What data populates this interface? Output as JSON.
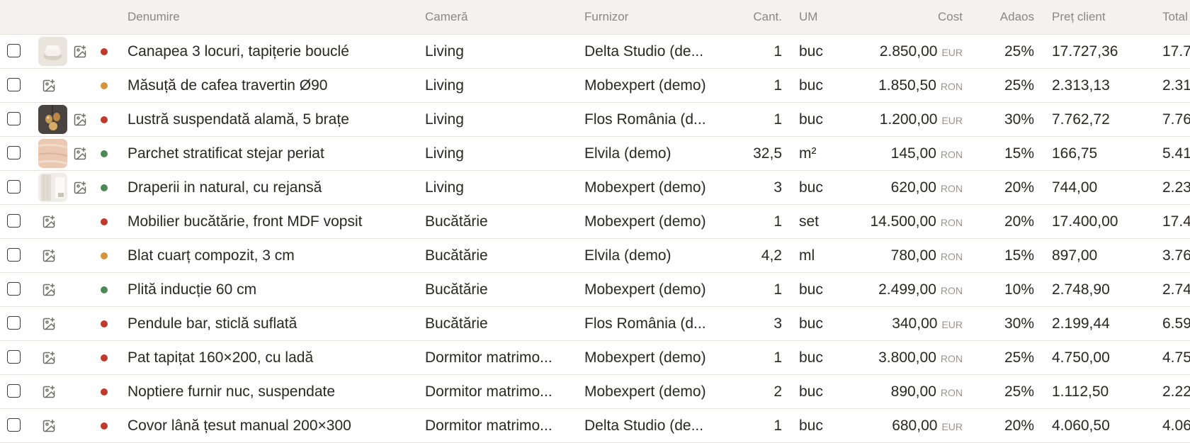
{
  "columns": {
    "name": "Denumire",
    "room": "Cameră",
    "supplier": "Furnizor",
    "qty": "Cant.",
    "um": "UM",
    "cost": "Cost",
    "markup": "Adaos",
    "client_price": "Preț client",
    "total": "Total"
  },
  "status_colors": {
    "red": "#c0392b",
    "orange": "#d4963a",
    "green": "#4a8a55"
  },
  "rows": [
    {
      "name": "Canapea 3 locuri, tapițerie bouclé",
      "room": "Living",
      "supplier": "Delta Studio (de...",
      "qty": "1",
      "um": "buc",
      "cost": "2.850,00",
      "currency": "EUR",
      "markup": "25%",
      "client_price": "17.727,36",
      "total": "17.7",
      "status": "red",
      "thumb": "sofa"
    },
    {
      "name": "Măsuță de cafea travertin Ø90",
      "room": "Living",
      "supplier": "Mobexpert (demo)",
      "qty": "1",
      "um": "buc",
      "cost": "1.850,50",
      "currency": "RON",
      "markup": "25%",
      "client_price": "2.313,13",
      "total": "2.31",
      "status": "orange",
      "thumb": ""
    },
    {
      "name": "Lustră suspendată alamă, 5 brațe",
      "room": "Living",
      "supplier": "Flos România (d...",
      "qty": "1",
      "um": "buc",
      "cost": "1.200,00",
      "currency": "EUR",
      "markup": "30%",
      "client_price": "7.762,72",
      "total": "7.76",
      "status": "red",
      "thumb": "lamp"
    },
    {
      "name": "Parchet stratificat stejar periat",
      "room": "Living",
      "supplier": "Elvila (demo)",
      "qty": "32,5",
      "um": "m²",
      "cost": "145,00",
      "currency": "RON",
      "markup": "15%",
      "client_price": "166,75",
      "total": "5.41",
      "status": "green",
      "thumb": "wood"
    },
    {
      "name": "Draperii in natural, cu rejansă",
      "room": "Living",
      "supplier": "Mobexpert (demo)",
      "qty": "3",
      "um": "buc",
      "cost": "620,00",
      "currency": "RON",
      "markup": "20%",
      "client_price": "744,00",
      "total": "2.23",
      "status": "green",
      "thumb": "curtain"
    },
    {
      "name": "Mobilier bucătărie, front MDF vopsit",
      "room": "Bucătărie",
      "supplier": "Mobexpert (demo)",
      "qty": "1",
      "um": "set",
      "cost": "14.500,00",
      "currency": "RON",
      "markup": "20%",
      "client_price": "17.400,00",
      "total": "17.4",
      "status": "red",
      "thumb": ""
    },
    {
      "name": "Blat cuarț compozit, 3 cm",
      "room": "Bucătărie",
      "supplier": "Elvila (demo)",
      "qty": "4,2",
      "um": "ml",
      "cost": "780,00",
      "currency": "RON",
      "markup": "15%",
      "client_price": "897,00",
      "total": "3.76",
      "status": "orange",
      "thumb": ""
    },
    {
      "name": "Plită inducție 60 cm",
      "room": "Bucătărie",
      "supplier": "Mobexpert (demo)",
      "qty": "1",
      "um": "buc",
      "cost": "2.499,00",
      "currency": "RON",
      "markup": "10%",
      "client_price": "2.748,90",
      "total": "2.74",
      "status": "green",
      "thumb": ""
    },
    {
      "name": "Pendule bar, sticlă suflată",
      "room": "Bucătărie",
      "supplier": "Flos România (d...",
      "qty": "3",
      "um": "buc",
      "cost": "340,00",
      "currency": "EUR",
      "markup": "30%",
      "client_price": "2.199,44",
      "total": "6.59",
      "status": "red",
      "thumb": ""
    },
    {
      "name": "Pat tapițat 160×200, cu ladă",
      "room": "Dormitor matrimo...",
      "supplier": "Mobexpert (demo)",
      "qty": "1",
      "um": "buc",
      "cost": "3.800,00",
      "currency": "RON",
      "markup": "25%",
      "client_price": "4.750,00",
      "total": "4.75",
      "status": "red",
      "thumb": ""
    },
    {
      "name": "Noptiere furnir nuc, suspendate",
      "room": "Dormitor matrimo...",
      "supplier": "Mobexpert (demo)",
      "qty": "2",
      "um": "buc",
      "cost": "890,00",
      "currency": "RON",
      "markup": "25%",
      "client_price": "1.112,50",
      "total": "2.22",
      "status": "red",
      "thumb": ""
    },
    {
      "name": "Covor lână țesut manual 200×300",
      "room": "Dormitor matrimo...",
      "supplier": "Delta Studio (de...",
      "qty": "1",
      "um": "buc",
      "cost": "680,00",
      "currency": "EUR",
      "markup": "20%",
      "client_price": "4.060,50",
      "total": "4.06",
      "status": "red",
      "thumb": ""
    }
  ]
}
